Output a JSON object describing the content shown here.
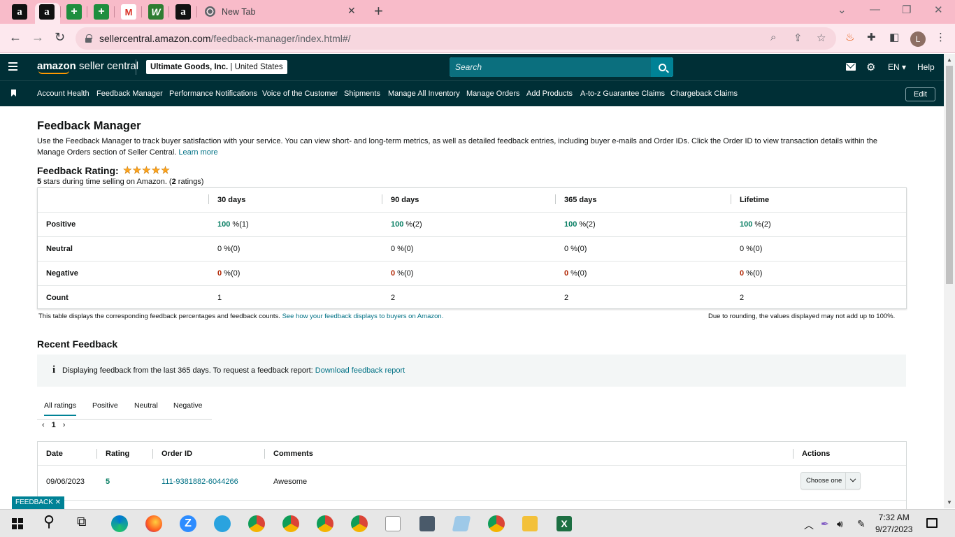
{
  "browser": {
    "new_tab_title": "New Tab",
    "url_host": "sellercentral.amazon.com",
    "url_path": "/feedback-manager/index.html#/",
    "profile_initial": "L"
  },
  "header": {
    "logo_main": "amazon",
    "logo_sub": "seller central",
    "account_name": "Ultimate Goods, Inc.",
    "account_region": "United States",
    "search_placeholder": "Search",
    "language": "EN",
    "help": "Help"
  },
  "nav": {
    "items": [
      "Account Health",
      "Feedback Manager",
      "Performance Notifications",
      "Voice of the Customer",
      "Shipments",
      "Manage All Inventory",
      "Manage Orders",
      "Add Products",
      "A-to-z Guarantee Claims",
      "Chargeback Claims"
    ],
    "edit_label": "Edit"
  },
  "page": {
    "title": "Feedback Manager",
    "description": "Use the Feedback Manager to track buyer satisfaction with your service. You can view short- and long-term metrics, as well as detailed feedback entries, including buyer e-mails and Order IDs. Click the Order ID to view transaction details within the Manage Orders section of Seller Central.",
    "learn_more": "Learn more",
    "rating_heading": "Feedback Rating:",
    "rating_stars": 5,
    "rating_sub_stars": "5",
    "rating_sub_text": " stars during time selling on Amazon. (",
    "rating_sub_count": "2",
    "rating_sub_end": " ratings)"
  },
  "summary": {
    "columns": [
      "30 days",
      "90 days",
      "365 days",
      "Lifetime"
    ],
    "rows": [
      {
        "label": "Positive",
        "cells": [
          {
            "pct": "100",
            "count": " %(1)"
          },
          {
            "pct": "100",
            "count": " %(2)"
          },
          {
            "pct": "100",
            "count": " %(2)"
          },
          {
            "pct": "100",
            "count": " %(2)"
          }
        ]
      },
      {
        "label": "Neutral",
        "cells": [
          {
            "pct": "0",
            "count": " %(0)"
          },
          {
            "pct": "0",
            "count": " %(0)"
          },
          {
            "pct": "0",
            "count": " %(0)"
          },
          {
            "pct": "0",
            "count": " %(0)"
          }
        ]
      },
      {
        "label": "Negative",
        "cells": [
          {
            "pct": "0",
            "count": " %(0)"
          },
          {
            "pct": "0",
            "count": " %(0)"
          },
          {
            "pct": "0",
            "count": " %(0)"
          },
          {
            "pct": "0",
            "count": " %(0)"
          }
        ]
      },
      {
        "label": "Count",
        "cells": [
          {
            "pct": "1",
            "count": ""
          },
          {
            "pct": "2",
            "count": ""
          },
          {
            "pct": "2",
            "count": ""
          },
          {
            "pct": "2",
            "count": ""
          }
        ]
      }
    ],
    "note_left": "This table displays the corresponding feedback percentages and feedback counts.",
    "note_left_link": "See how your feedback displays to buyers on Amazon.",
    "note_right": "Due to rounding, the values displayed may not add up to 100%."
  },
  "recent": {
    "heading": "Recent Feedback",
    "info_text": "Displaying feedback from the last 365 days. To request a feedback report:",
    "info_link": "Download feedback report",
    "tabs": [
      "All ratings",
      "Positive",
      "Neutral",
      "Negative"
    ],
    "page_number": "1",
    "columns": [
      "Date",
      "Rating",
      "Order ID",
      "Comments",
      "Actions"
    ],
    "rows": [
      {
        "date": "09/06/2023",
        "rating": "5",
        "order_id": "111-9381882-6044266",
        "comment": "Awesome",
        "action": "Choose one"
      }
    ],
    "feedback_tab": "FEEDBACK ✕"
  },
  "taskbar": {
    "time": "7:32 AM",
    "date": "9/27/2023"
  },
  "colors": {
    "header_bg": "#002f36",
    "tab_strip": "#f8bbc9",
    "positive": "#067d62",
    "negative": "#b12704",
    "link": "#007185",
    "star": "#ffa41c"
  }
}
